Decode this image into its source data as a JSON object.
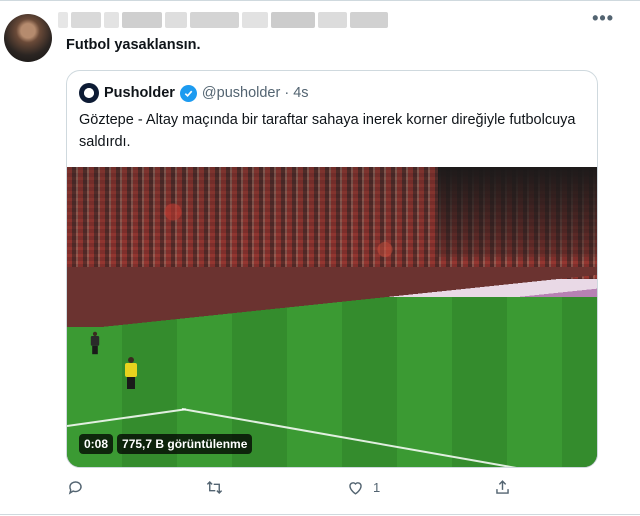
{
  "tweet": {
    "text": "Futbol yasaklansın.",
    "more_icon": "•••"
  },
  "quote": {
    "name": "Pusholder",
    "handle": "@pusholder · 4s",
    "text": "Göztepe - Altay maçında bir taraftar sahaya inerek korner direğiyle futbolcuya saldırdı.",
    "video": {
      "duration": "0:08",
      "views": "775,7 B görüntülenme"
    }
  },
  "actions": {
    "reply_icon": "reply-icon",
    "retweet_icon": "retweet-icon",
    "like_icon": "heart-icon",
    "like_count": "1",
    "share_icon": "share-icon"
  },
  "colors": {
    "verified": "#1d9bf0",
    "icon_gray": "#536471",
    "border": "#cfd9de"
  }
}
